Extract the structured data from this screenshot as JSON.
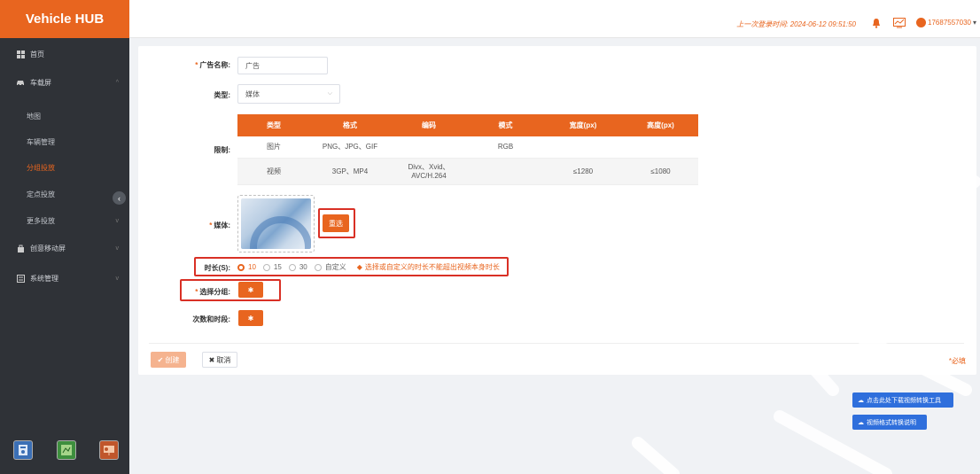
{
  "sidebar": {
    "brand": "Vehicle HUB",
    "items": [
      {
        "label": "首页",
        "icon": "dashboard-icon"
      },
      {
        "label": "车载屏",
        "icon": "car-icon",
        "chevron": "^"
      },
      {
        "label": "地图"
      },
      {
        "label": "车辆管理"
      },
      {
        "label": "分组投放",
        "active": true
      },
      {
        "label": "定点投放"
      },
      {
        "label": "更多投放",
        "chevron": "v"
      },
      {
        "label": "创意移动屏",
        "icon": "bag-icon",
        "chevron": "v"
      },
      {
        "label": "系统管理",
        "icon": "settings-icon",
        "chevron": "v"
      }
    ],
    "tools": [
      "calculator-icon",
      "map-tool-icon",
      "presentation-icon"
    ]
  },
  "topbar": {
    "last_login": "上一次登录时间: 2024-06-12 09:51:50",
    "username": "17687557030"
  },
  "form": {
    "ad_name_label": "广告名称:",
    "ad_name_value": "广告",
    "type_label": "类型:",
    "type_value": "媒体",
    "limit_label": "限制:",
    "media_label": "媒体:",
    "reselect_label": "重选",
    "duration_label": "时长(S):",
    "duration_options": [
      {
        "label": "10",
        "selected": true
      },
      {
        "label": "15",
        "selected": false
      },
      {
        "label": "30",
        "selected": false
      },
      {
        "label": "自定义",
        "selected": false
      }
    ],
    "duration_hint": "选择或自定义的时长不能超出视频本身时长",
    "group_label": "选择分组:",
    "times_label": "次数和时段:",
    "create_label": "创建",
    "cancel_label": "取消",
    "required_note": "*必填"
  },
  "limits_table": {
    "headers": [
      "类型",
      "格式",
      "编码",
      "模式",
      "宽度(px)",
      "高度(px)"
    ],
    "rows": [
      [
        "图片",
        "PNG、JPG、GIF",
        "",
        "RGB",
        "",
        ""
      ],
      [
        "视频",
        "3GP、MP4",
        "Divx、Xvid、AVC/H.264",
        "",
        "≤1280",
        "≤1080"
      ]
    ]
  },
  "help_buttons": {
    "download_tool": "点击此处下载视频转换工具",
    "convert_guide": "视频格式转换说明"
  },
  "colors": {
    "accent": "#e8651f",
    "sidebar_bg": "#2f3237",
    "highlight_border": "#d93025",
    "blue": "#2f6fdc"
  }
}
